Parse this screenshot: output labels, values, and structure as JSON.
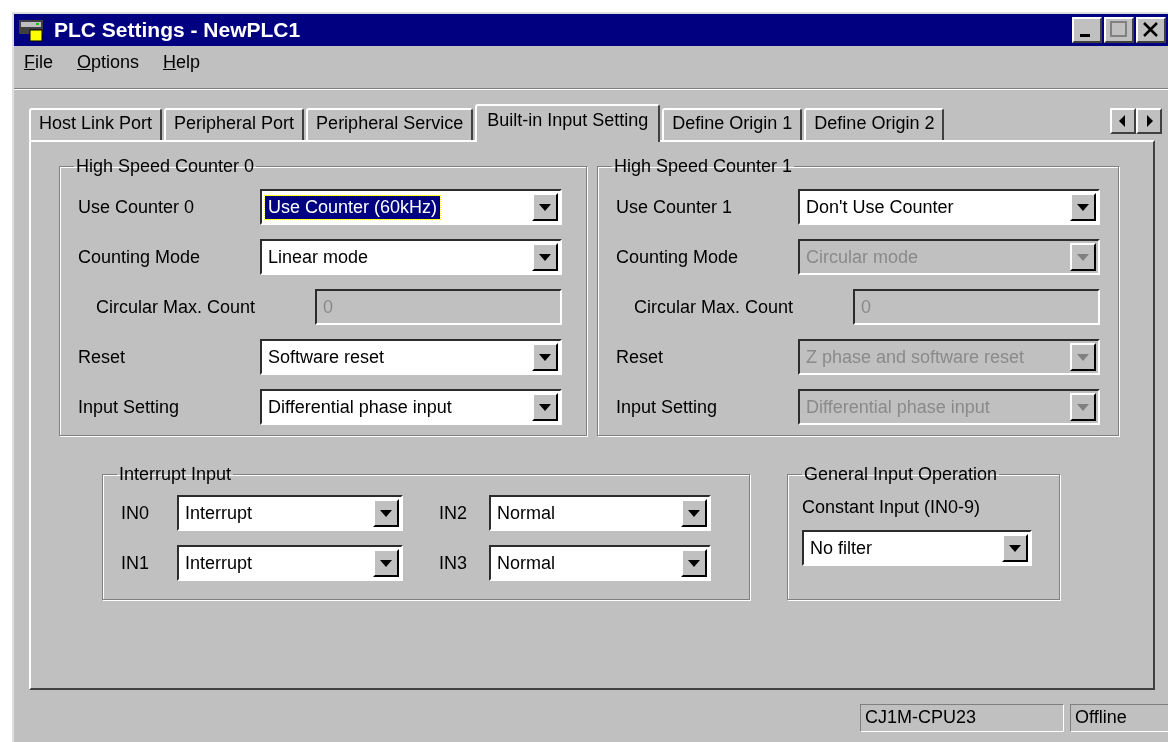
{
  "window": {
    "title": "PLC Settings - NewPLC1"
  },
  "menu": [
    {
      "label": "File"
    },
    {
      "label": "Options"
    },
    {
      "label": "Help"
    }
  ],
  "tabs": [
    {
      "label": "Host Link Port",
      "selected": false
    },
    {
      "label": "Peripheral Port",
      "selected": false
    },
    {
      "label": "Peripheral Service",
      "selected": false
    },
    {
      "label": "Built-in Input Setting",
      "selected": true
    },
    {
      "label": "Define Origin 1",
      "selected": false
    },
    {
      "label": "Define Origin 2",
      "selected": false
    }
  ],
  "counters": [
    {
      "title": "High Speed Counter 0",
      "fields": [
        {
          "kind": "combo",
          "label": "Use Counter 0",
          "value": "Use Counter (60kHz)",
          "disabled": false,
          "focused": true
        },
        {
          "kind": "combo",
          "label": "Counting Mode",
          "value": "Linear mode",
          "disabled": false,
          "focused": false
        },
        {
          "kind": "text",
          "label": "Circular Max. Count",
          "value": "0",
          "disabled": true
        },
        {
          "kind": "combo",
          "label": "Reset",
          "value": "Software reset",
          "disabled": false,
          "focused": false
        },
        {
          "kind": "combo",
          "label": "Input Setting",
          "value": "Differential phase input",
          "disabled": false,
          "focused": false
        }
      ]
    },
    {
      "title": "High Speed Counter 1",
      "fields": [
        {
          "kind": "combo",
          "label": "Use Counter 1",
          "value": "Don't Use Counter",
          "disabled": false,
          "focused": false
        },
        {
          "kind": "combo",
          "label": "Counting Mode",
          "value": "Circular mode",
          "disabled": true,
          "focused": false
        },
        {
          "kind": "text",
          "label": "Circular Max. Count",
          "value": "0",
          "disabled": true
        },
        {
          "kind": "combo",
          "label": "Reset",
          "value": "Z phase and software reset",
          "disabled": true,
          "focused": false
        },
        {
          "kind": "combo",
          "label": "Input Setting",
          "value": "Differential phase input",
          "disabled": true,
          "focused": false
        }
      ]
    }
  ],
  "interrupt_input": {
    "title": "Interrupt Input",
    "inputs": [
      {
        "label": "IN0",
        "value": "Interrupt"
      },
      {
        "label": "IN2",
        "value": "Normal"
      },
      {
        "label": "IN1",
        "value": "Interrupt"
      },
      {
        "label": "IN3",
        "value": "Normal"
      }
    ]
  },
  "general_input_operation": {
    "title": "General Input Operation",
    "label": "Constant Input (IN0-9)",
    "value": "No filter"
  },
  "status_bar": [
    "CJ1M-CPU23",
    "Offline"
  ]
}
